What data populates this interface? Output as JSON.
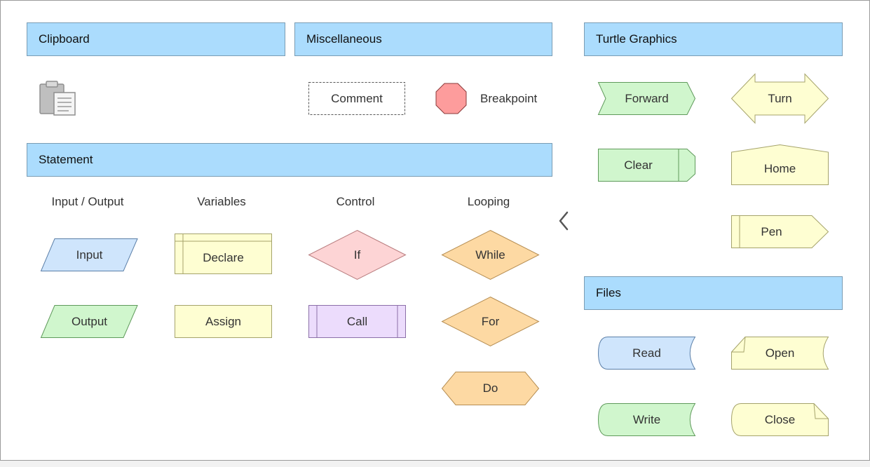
{
  "sections": {
    "clipboard": "Clipboard",
    "misc": "Miscellaneous",
    "turtle": "Turtle Graphics",
    "statement": "Statement",
    "files": "Files"
  },
  "misc": {
    "comment": "Comment",
    "breakpoint": "Breakpoint"
  },
  "statement_columns": {
    "io": "Input / Output",
    "variables": "Variables",
    "control": "Control",
    "looping": "Looping"
  },
  "statement_shapes": {
    "input": "Input",
    "output": "Output",
    "declare": "Declare",
    "assign": "Assign",
    "if": "If",
    "call": "Call",
    "while": "While",
    "for": "For",
    "do": "Do"
  },
  "turtle_shapes": {
    "forward": "Forward",
    "turn": "Turn",
    "clear": "Clear",
    "home": "Home",
    "pen": "Pen"
  },
  "file_shapes": {
    "read": "Read",
    "open": "Open",
    "write": "Write",
    "close": "Close"
  },
  "icons": {
    "clipboard": "clipboard-icon",
    "collapse": "chevron-left-icon"
  },
  "colors": {
    "header_fill": "#abdcfd",
    "io_fill": "#cfe5fc",
    "output_fill": "#d0f6cd",
    "variable_fill": "#fefed2",
    "if_fill": "#fdd4d5",
    "call_fill": "#ecdcfc",
    "loop_fill": "#fdd9a3",
    "turtle_green": "#d0f6cd",
    "turtle_yellow": "#fefed2",
    "breakpoint_fill": "#fd9c9c"
  }
}
